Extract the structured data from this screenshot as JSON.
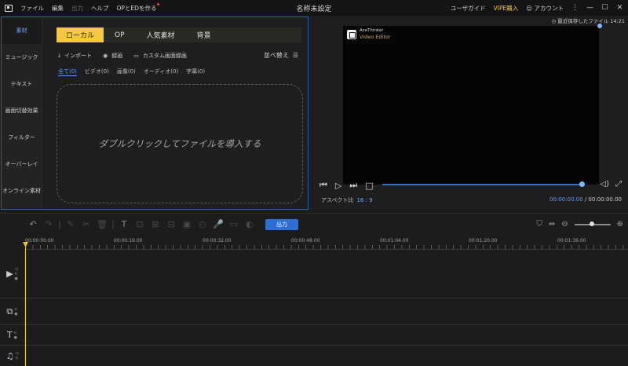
{
  "titlebar": {
    "menu": [
      "ファイル",
      "編集",
      "出力",
      "ヘルプ",
      "OPとEDを作る"
    ],
    "title": "名称未設定",
    "guide": "ユーザガイド",
    "vip": "VIPE購入",
    "account": "アカウント"
  },
  "sidenav": [
    "素材",
    "ミュージック",
    "テキスト",
    "画面切替効果",
    "フィルター",
    "オーバーレイ",
    "オンライン素材"
  ],
  "library": {
    "tabs": [
      "ローカル",
      "OP",
      "人気素材",
      "背景"
    ],
    "actions": {
      "import": "インポート",
      "record": "録画",
      "custom_record": "カスタム画面録画",
      "sort": "並べ替え"
    },
    "filters": [
      "全て(0)",
      "ビデオ(0)",
      "画像(0)",
      "オーディオ(0)",
      "字幕(0)"
    ],
    "dropzone_text": "ダブルクリックしてファイルを導入する"
  },
  "preview": {
    "last_saved": "最近保存したファイル 14:21",
    "watermark_line1": "AceThinker",
    "watermark_line2": "Video Editor",
    "aspect_label": "アスペクト比",
    "aspect_value": "16 : 9",
    "current_time": "00:00:00.00",
    "separator": "/",
    "total_time": "00:00:00.00",
    "progress": 1.0
  },
  "toolbar": {
    "export_label": "出力"
  },
  "ruler": [
    "00:00:00.00",
    "00:00:16.00",
    "00:00:32.00",
    "00:00:48.00",
    "00:01:04.00",
    "00:01:20.00",
    "00:01:36.00"
  ],
  "colors": {
    "accent": "#2e6fd4",
    "tab_active": "#f5c842",
    "playhead": "#e8c53a",
    "panel_border": "#2b5f9e"
  }
}
